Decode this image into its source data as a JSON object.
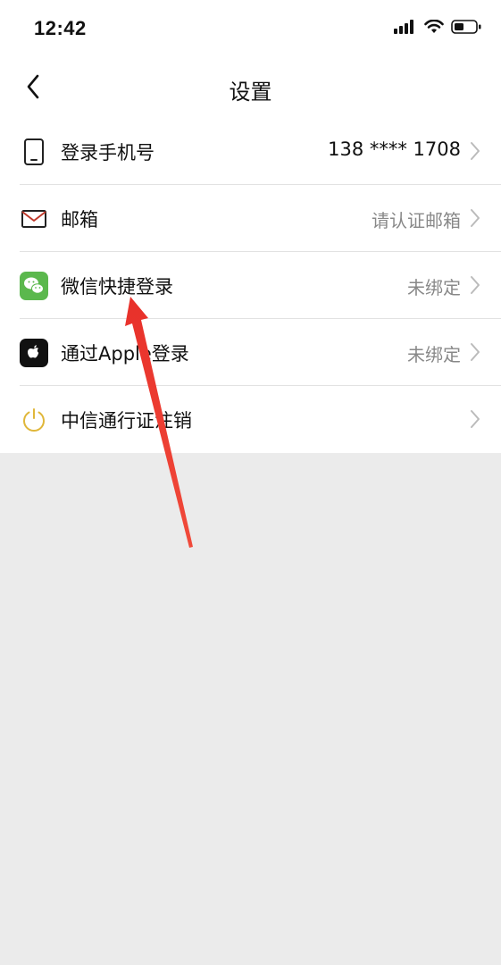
{
  "status_bar": {
    "time": "12:42"
  },
  "nav": {
    "title": "设置"
  },
  "settings": [
    {
      "label": "登录手机号",
      "value": "138 **** 1708",
      "icon": "phone-icon"
    },
    {
      "label": "邮箱",
      "value": "请认证邮箱",
      "icon": "mail-icon"
    },
    {
      "label": "微信快捷登录",
      "value": "未绑定",
      "icon": "wechat-icon"
    },
    {
      "label": "通过Apple登录",
      "value": "未绑定",
      "icon": "apple-icon"
    },
    {
      "label": "中信通行证注销",
      "value": "",
      "icon": "power-icon"
    }
  ],
  "colors": {
    "wechat_green": "#5bb84d",
    "power_gold": "#e0b73a",
    "annotation_red": "#e8302a",
    "page_background": "#ebebeb"
  }
}
